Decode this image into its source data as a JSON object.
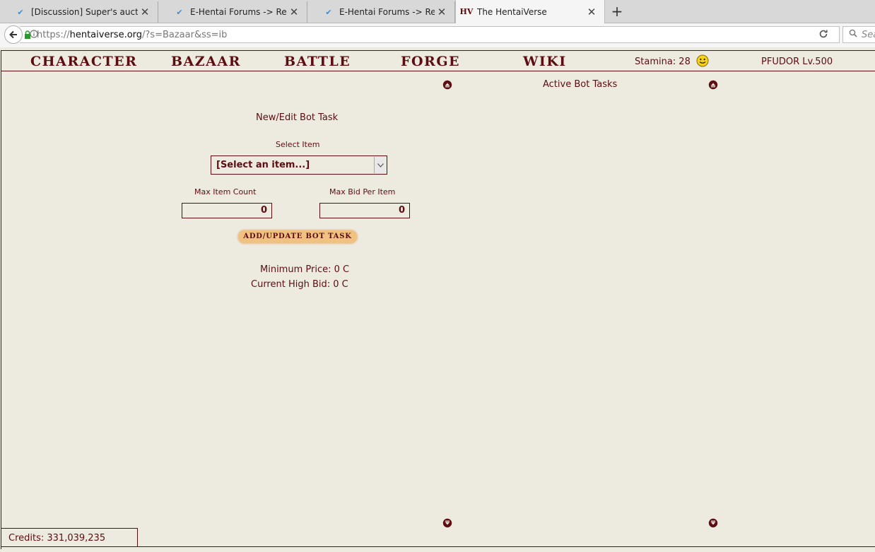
{
  "browser": {
    "tabs": [
      {
        "title": "[Discussion] Super's auction",
        "active": false
      },
      {
        "title": "E-Hentai Forums -> Replying",
        "active": false
      },
      {
        "title": "E-Hentai Forums -> Replying",
        "active": false
      },
      {
        "title": "The HentaiVerse",
        "active": true
      }
    ],
    "url_prefix": "https://",
    "url_domain": "hentaiverse.org",
    "url_rest": "/?s=Bazaar&ss=ib",
    "search_placeholder": "Sea",
    "new_tab": "+",
    "close_glyph": "✕",
    "favicon_forum": "✔",
    "favicon_hv": "HV"
  },
  "menu": {
    "items": [
      "CHARACTER",
      "BAZAAR",
      "BATTLE",
      "FORGE",
      "WIKI"
    ],
    "stamina": "Stamina: 28",
    "player": "PFUDOR Lv.500"
  },
  "left_panel": {
    "title": "New/Edit Bot Task",
    "select_label": "Select Item",
    "select_value": "[Select an item...]",
    "max_count_label": "Max Item Count",
    "max_count_value": "0",
    "max_bid_label": "Max Bid Per Item",
    "max_bid_value": "0",
    "button_label": "ADD/UPDATE BOT TASK",
    "min_price": "Minimum Price: 0 C",
    "high_bid": "Current High Bid: 0 C"
  },
  "right_panel": {
    "title": "Active Bot Tasks"
  },
  "footer": {
    "credits": "Credits: 331,039,235"
  },
  "colors": {
    "accent": "#5c0d11",
    "background": "#edeae0",
    "button": "#f0c281"
  }
}
